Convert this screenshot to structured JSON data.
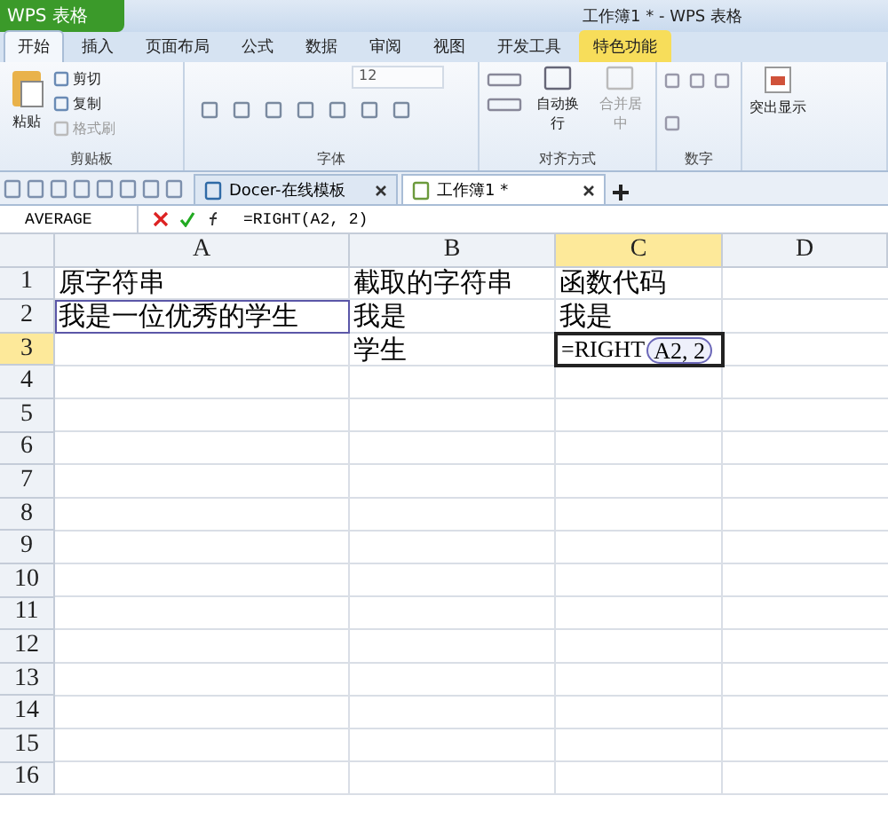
{
  "app_button": "WPS 表格",
  "window_title": "工作簿1 * - WPS 表格",
  "ribbon_tabs": [
    {
      "label": "开始",
      "selected": true,
      "kind": "normal"
    },
    {
      "label": "插入",
      "selected": false,
      "kind": "normal"
    },
    {
      "label": "页面布局",
      "selected": false,
      "kind": "normal"
    },
    {
      "label": "公式",
      "selected": false,
      "kind": "normal"
    },
    {
      "label": "数据",
      "selected": false,
      "kind": "normal"
    },
    {
      "label": "审阅",
      "selected": false,
      "kind": "normal"
    },
    {
      "label": "视图",
      "selected": false,
      "kind": "normal"
    },
    {
      "label": "开发工具",
      "selected": false,
      "kind": "normal"
    },
    {
      "label": "特色功能",
      "selected": false,
      "kind": "special"
    }
  ],
  "clipboard": {
    "title": "剪贴板",
    "paste": "粘贴",
    "actions": [
      {
        "label": "剪切",
        "disabled": false
      },
      {
        "label": "复制",
        "disabled": false
      },
      {
        "label": "格式刷",
        "disabled": true
      }
    ]
  },
  "font": {
    "title": "字体",
    "size": "12"
  },
  "alignment": {
    "title": "对齐方式",
    "actions": [
      {
        "label": "自动换行",
        "disabled": false
      },
      {
        "label": "合并居中",
        "disabled": true
      }
    ]
  },
  "number": {
    "title": "数字"
  },
  "highlight": {
    "label": "突出显示"
  },
  "doc_tabs": [
    {
      "label": "Docer-在线模板",
      "selected": false
    },
    {
      "label": "工作簿1 *",
      "selected": true
    }
  ],
  "formula_bar": {
    "name_box": "AVERAGE",
    "formula": "=RIGHT(A2, 2)"
  },
  "columns": [
    {
      "label": "A",
      "selected": false
    },
    {
      "label": "B",
      "selected": false
    },
    {
      "label": "C",
      "selected": true
    },
    {
      "label": "D",
      "selected": false
    }
  ],
  "rows": [
    {
      "label": "1",
      "selected": false,
      "cells": {
        "A": {
          "text": "原字符串",
          "referenced": false,
          "editing": false
        },
        "B": {
          "text": "截取的字符串",
          "referenced": false,
          "editing": false
        },
        "C": {
          "text": "函数代码",
          "referenced": false,
          "editing": false
        }
      }
    },
    {
      "label": "2",
      "selected": false,
      "cells": {
        "A": {
          "text": "我是一位优秀的学生",
          "referenced": true,
          "editing": false
        },
        "B": {
          "text": "我是",
          "referenced": false,
          "editing": false
        },
        "C": {
          "text": "我是",
          "referenced": false,
          "editing": false
        }
      }
    },
    {
      "label": "3",
      "selected": true,
      "cells": {
        "B": {
          "text": "学生",
          "referenced": false,
          "editing": false
        },
        "C": {
          "text": "=RIGHT",
          "arguments": "A2, 2",
          "referenced": false,
          "editing": true
        }
      }
    },
    {
      "label": "4",
      "selected": false
    },
    {
      "label": "5",
      "selected": false
    },
    {
      "label": "6",
      "selected": false
    },
    {
      "label": "7",
      "selected": false
    },
    {
      "label": "8",
      "selected": false
    },
    {
      "label": "9",
      "selected": false
    },
    {
      "label": "10",
      "selected": false
    },
    {
      "label": "11",
      "selected": false
    },
    {
      "label": "12",
      "selected": false
    },
    {
      "label": "13",
      "selected": false
    },
    {
      "label": "14",
      "selected": false
    },
    {
      "label": "15",
      "selected": false
    },
    {
      "label": "16",
      "selected": false
    }
  ]
}
